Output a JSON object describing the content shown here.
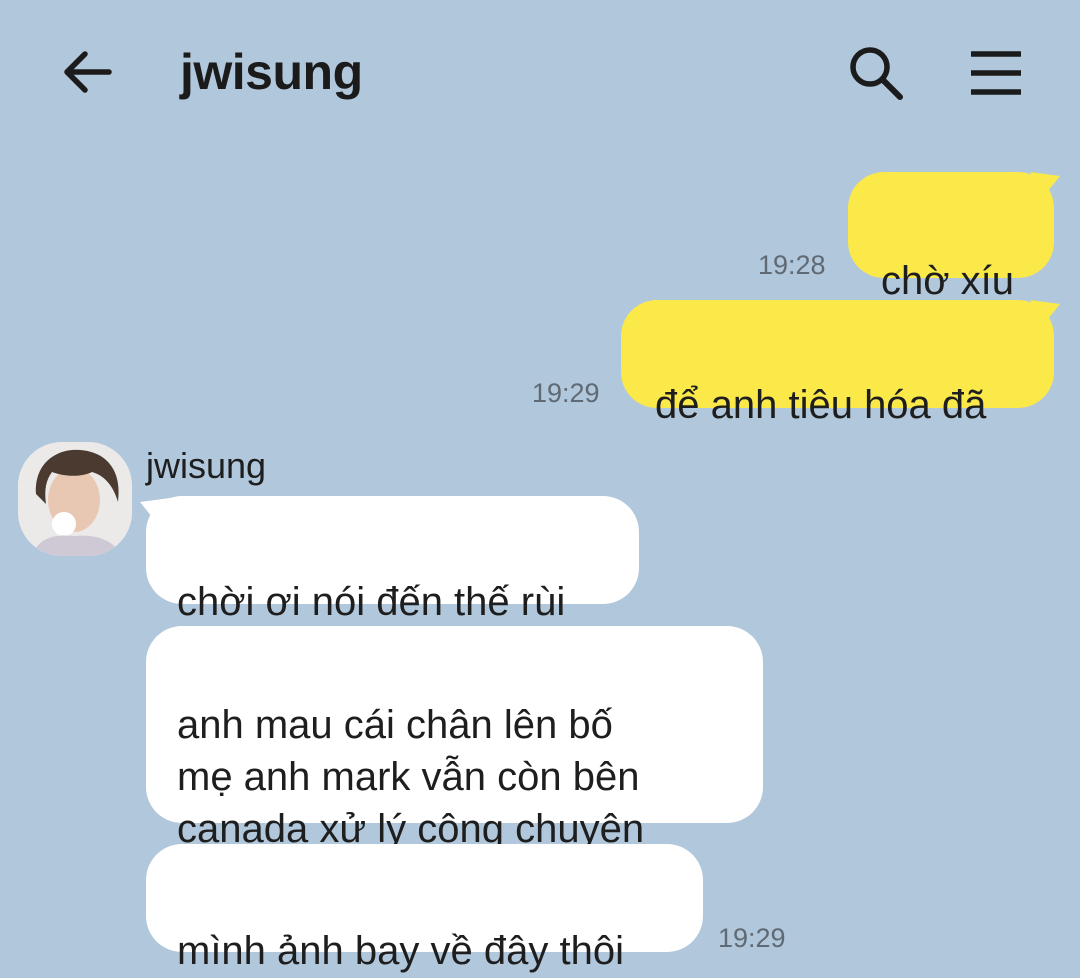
{
  "header": {
    "title": "jwisung",
    "back_icon": "arrow-left-icon",
    "search_icon": "search-icon",
    "menu_icon": "hamburger-menu-icon"
  },
  "colors": {
    "background": "#b1c7dc",
    "my_bubble": "#fbe94a",
    "their_bubble": "#ffffff",
    "timestamp": "#5f6a74"
  },
  "messages": {
    "sent": [
      {
        "text": "chờ xíu",
        "time": "19:28"
      },
      {
        "text": "để anh tiêu hóa đã",
        "time": "19:29"
      }
    ],
    "received": {
      "sender": "jwisung",
      "items": [
        {
          "text": "chời ơi nói đến thế rùi"
        },
        {
          "text": "anh mau cái chân lên bố\nmẹ anh mark vẫn còn bên\ncanada xử lý công chuyện"
        },
        {
          "text": "mình ảnh bay về đây thôi",
          "time": "19:29"
        }
      ]
    }
  }
}
